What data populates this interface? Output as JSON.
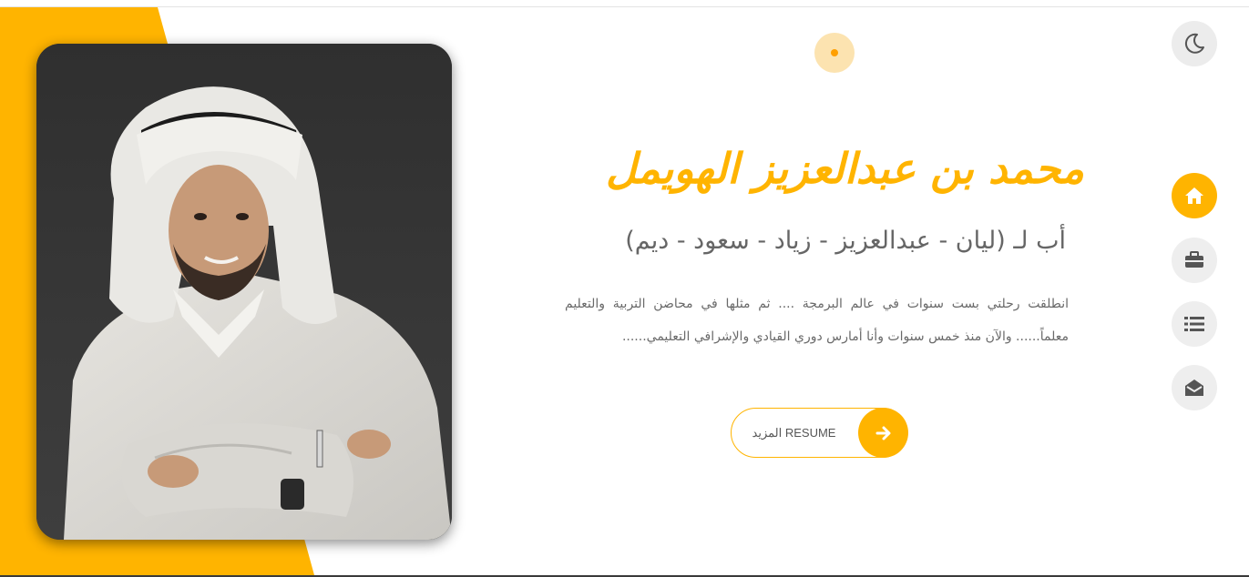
{
  "hero": {
    "name": "محمد بن عبدالعزيز الهويمل",
    "subtitle": "أب لـ (ليان - عبدالعزيز - زياد - سعود - ديم)",
    "bio": "انطلقت رحلتي بست سنوات في عالم البرمجة .... ثم مثلها في محاضن التربية والتعليم معلماً...... والآن منذ خمس سنوات وأنا أمارس دوري القيادي والإشرافي التعليمي......",
    "more_button_label": "المزيد RESUME",
    "more_button_icon": "arrow-right-icon"
  },
  "toolbar": {
    "theme_toggle_icon": "moon-icon"
  },
  "nav": {
    "items": [
      {
        "id": "home",
        "icon": "home-icon",
        "active": true
      },
      {
        "id": "portfolio",
        "icon": "briefcase-icon",
        "active": false
      },
      {
        "id": "list",
        "icon": "list-icon",
        "active": false
      },
      {
        "id": "contact",
        "icon": "envelope-open-icon",
        "active": false
      }
    ]
  },
  "colors": {
    "accent": "#ffb400",
    "text_gray": "#666666",
    "button_gray": "#eeeeee",
    "dot_light": "#fce3b0",
    "dot_center": "#ff9f00"
  }
}
